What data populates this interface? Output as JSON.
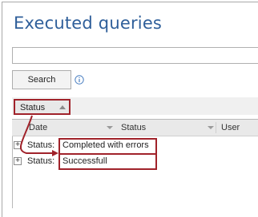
{
  "window": {
    "title": "Executed queries"
  },
  "search": {
    "value": "",
    "button_label": "Search",
    "info_icon": "info-icon"
  },
  "group_panel": {
    "chip_label": "Status",
    "chip_sort": "ascending"
  },
  "grid": {
    "columns": [
      {
        "label": "Date"
      },
      {
        "label": "Status"
      },
      {
        "label": "User"
      }
    ],
    "groups": [
      {
        "prefix": "Status:",
        "value": "Completed with errors",
        "expander": "+"
      },
      {
        "prefix": "Status:",
        "value": "Successfull",
        "expander": "+"
      }
    ]
  },
  "annotation": {
    "color": "#a0222a"
  }
}
